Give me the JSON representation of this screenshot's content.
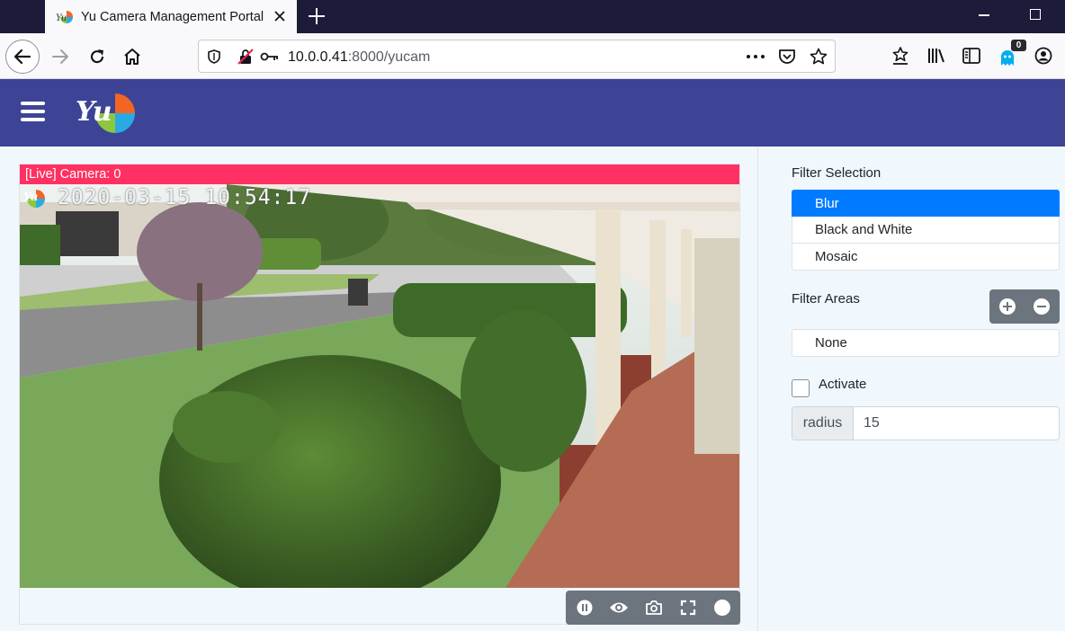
{
  "browser": {
    "tab_title": "Yu Camera Management Portal",
    "url_host": "10.0.0.41",
    "url_path": ":8000/yucam",
    "extension_badge": "0"
  },
  "camera": {
    "label": "[Live] Camera: 0",
    "timestamp": "2020-03-15  10:54:17",
    "controls": [
      "pause-icon",
      "eye-icon",
      "camera-icon",
      "fullscreen-icon",
      "record-dot-icon"
    ]
  },
  "sidebar": {
    "filter_selection_label": "Filter Selection",
    "filters": [
      {
        "label": "Blur",
        "active": true
      },
      {
        "label": "Black and White",
        "active": false
      },
      {
        "label": "Mosaic",
        "active": false
      }
    ],
    "filter_areas_label": "Filter Areas",
    "areas": [
      "None"
    ],
    "activate_label": "Activate",
    "activate_checked": false,
    "radius_label": "radius",
    "radius_value": "15"
  },
  "colors": {
    "app_header": "#3d4496",
    "live_banner": "#ff3162",
    "active_filter": "#007bff",
    "control_bar": "#6c757d"
  }
}
